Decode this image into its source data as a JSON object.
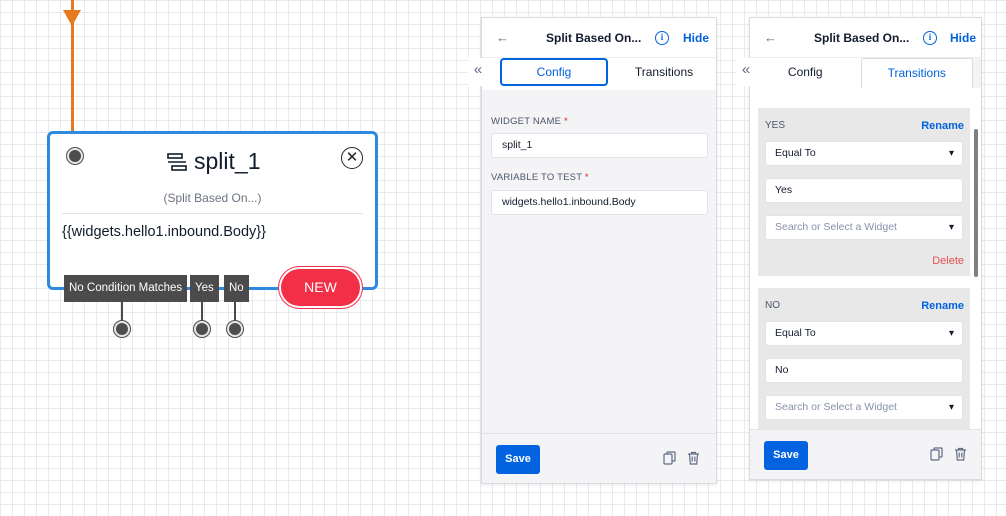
{
  "canvas": {
    "widget": {
      "name": "split_1",
      "type_label": "(Split Based On...)",
      "variable": "{{widgets.hello1.inbound.Body}}",
      "close_icon": "close-circle-icon",
      "type_icon": "split-icon",
      "transitions": [
        "No Condition Matches",
        "Yes",
        "No"
      ],
      "new_button": "NEW",
      "border_color": "#2d8ae0",
      "edge_color": "#e77a1f",
      "new_color": "#f22f46"
    }
  },
  "config_panel": {
    "back_icon": "arrow-left-icon",
    "title": "Split Based On...",
    "info_icon": "info-icon",
    "hide_label": "Hide",
    "collapse_icon": "double-chevron-left-icon",
    "tabs": [
      "Config",
      "Transitions"
    ],
    "active_tab": "Config",
    "widget_name_label": "WIDGET NAME",
    "widget_name_value": "split_1",
    "variable_label": "VARIABLE TO TEST",
    "variable_value": "widgets.hello1.inbound.Body",
    "required_mark": "*",
    "save_label": "Save",
    "copy_icon": "copy-icon",
    "delete_icon": "trash-icon"
  },
  "transitions_panel": {
    "back_icon": "arrow-left-icon",
    "title": "Split Based On...",
    "info_icon": "info-icon",
    "hide_label": "Hide",
    "collapse_icon": "double-chevron-left-icon",
    "tabs": [
      "Config",
      "Transitions"
    ],
    "active_tab": "Transitions",
    "conditions": [
      {
        "label": "YES",
        "rename": "Rename",
        "operator": "Equal To",
        "value": "Yes",
        "widget_placeholder": "Search or Select a Widget",
        "delete": "Delete"
      },
      {
        "label": "NO",
        "rename": "Rename",
        "operator": "Equal To",
        "value": "No",
        "widget_placeholder": "Search or Select a Widget"
      }
    ],
    "save_label": "Save",
    "copy_icon": "copy-icon",
    "delete_icon": "trash-icon"
  },
  "colors": {
    "primary": "#0263e0",
    "danger": "#e35252"
  }
}
